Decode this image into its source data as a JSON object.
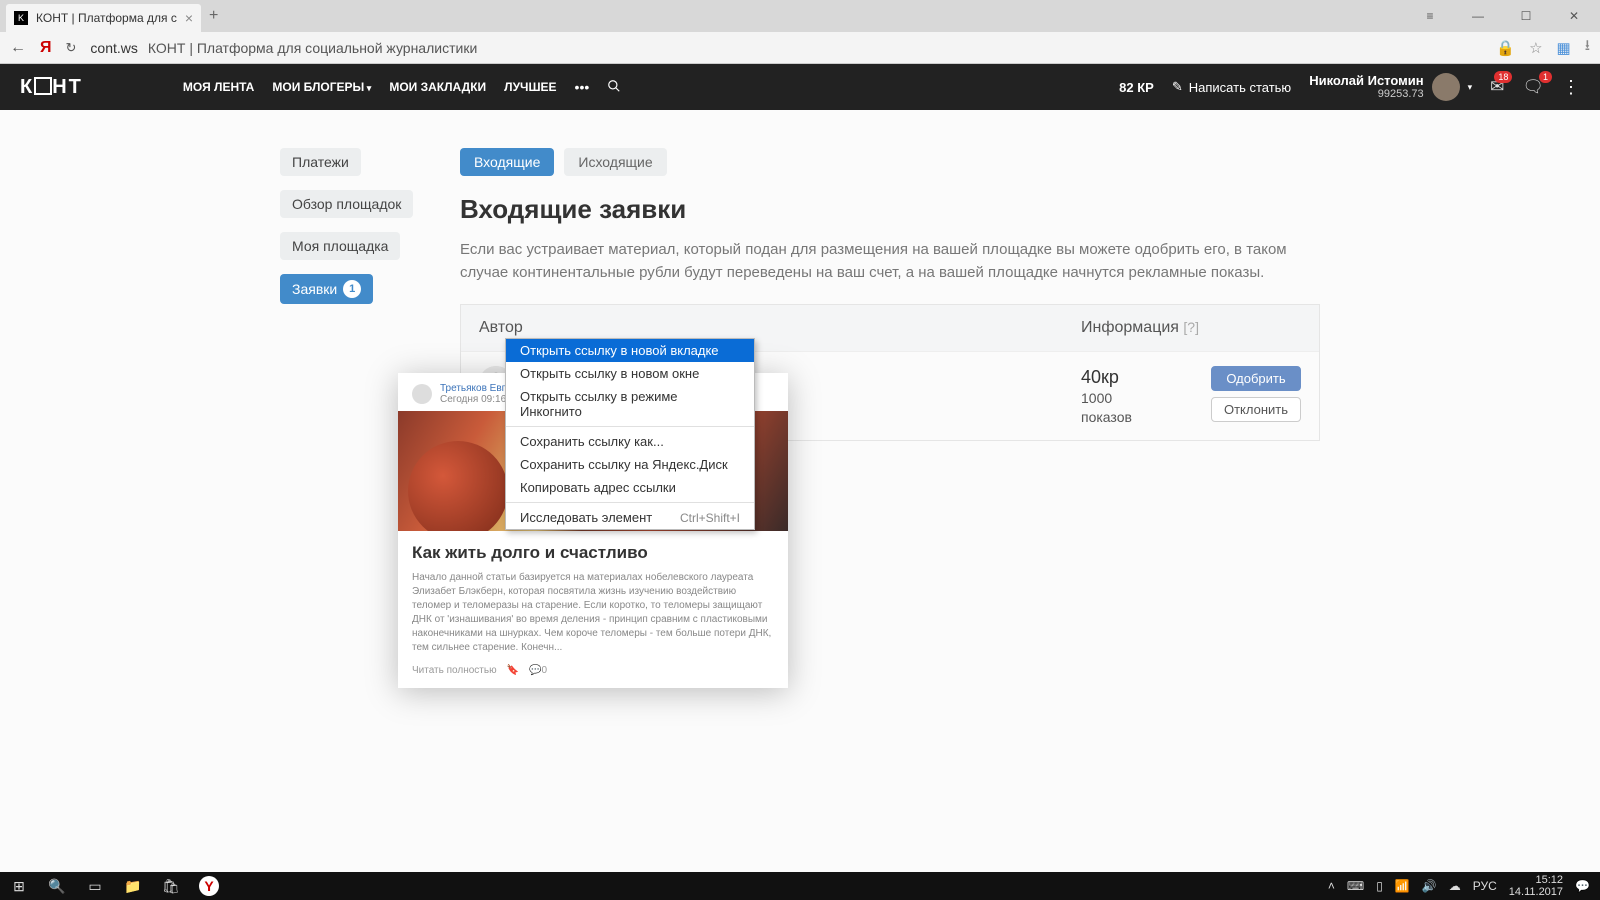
{
  "browser": {
    "tab_title": "КОНТ | Платформа для с",
    "url_host": "cont.ws",
    "url_title": "КОНТ | Платформа для социальной журналистики"
  },
  "header": {
    "logo": "КОНТ",
    "nav": {
      "feed": "МОЯ ЛЕНТА",
      "bloggers": "МОИ БЛОГЕРЫ",
      "bookmarks": "МОИ ЗАКЛАДКИ",
      "best": "ЛУЧШЕЕ"
    },
    "kp": "82 КР",
    "write": "Написать статью",
    "user": {
      "name": "Николай Истомин",
      "balance": "99253.73"
    },
    "badges": {
      "mail": "18",
      "notif": "1"
    }
  },
  "sidebar": {
    "payments": "Платежи",
    "overview": "Обзор площадок",
    "myplace": "Моя площадка",
    "requests": "Заявки",
    "requests_count": "1"
  },
  "tabs": {
    "in": "Входящие",
    "out": "Исходящие"
  },
  "page": {
    "title": "Входящие заявки",
    "desc": "Если вас устраивает материал, который подан для размещения на вашей площадке вы можете одобрить его, в таком случае континентальные рубли будут переведены на ваш счет, а на вашей площадке начнутся рекламные показы."
  },
  "table": {
    "col_author": "Автор",
    "col_info": "Информация",
    "qmark": "[?]",
    "row": {
      "title": "Как жить долго и счастливо",
      "author": "Третьяко",
      "price": "40кр",
      "views": "1000",
      "views_label": "показов"
    },
    "approve": "Одобрить",
    "reject": "Отклонить"
  },
  "card": {
    "author": "Третьяков Евгений",
    "time": "Сегодня 09:16",
    "title": "Как жить долго и счастливо",
    "text": "Начало данной статьи базируется на материалах нобелевского лауреата Элизабет Блэкберн, которая посвятила жизнь изучению воздействию теломер и теломеразы на старение. Если коротко, то теломеры защищают ДНК от 'изнашивания' во время деления - принцип сравним с пластиковыми наконечниками на шнурках. Чем короче теломеры - тем больше потери ДНК, тем сильнее старение. Конечн...",
    "read": "Читать полностью",
    "comments": "0"
  },
  "ctx": {
    "newtab": "Открыть ссылку в новой вкладке",
    "newwin": "Открыть ссылку в новом окне",
    "incognito": "Открыть ссылку в режиме Инкогнито",
    "saveas": "Сохранить ссылку как...",
    "yadisk": "Сохранить ссылку на Яндекс.Диск",
    "copy": "Копировать адрес ссылки",
    "inspect": "Исследовать элемент",
    "inspect_key": "Ctrl+Shift+I"
  },
  "taskbar": {
    "lang": "РУС",
    "time": "15:12",
    "date": "14.11.2017"
  }
}
